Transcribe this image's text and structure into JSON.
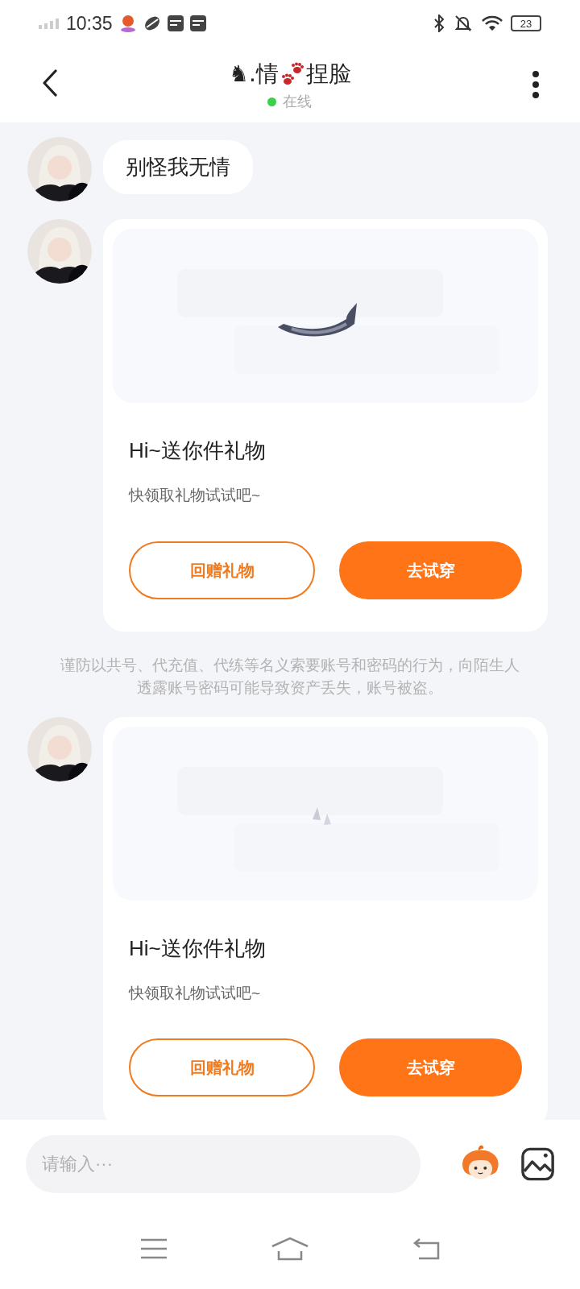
{
  "status_bar": {
    "time": "10:35",
    "battery": "23"
  },
  "header": {
    "title_parts": [
      "♞.情",
      "捏脸"
    ],
    "status": "在线",
    "online": true
  },
  "messages": [
    {
      "kind": "text",
      "text": "别怪我无情"
    },
    {
      "kind": "gift",
      "title": "Hi~送你件礼物",
      "subtitle": "快领取礼物试试吧~",
      "buttons": [
        {
          "label": "回赠礼物",
          "kind": "secondary"
        },
        {
          "label": "去试穿",
          "kind": "primary"
        }
      ]
    },
    {
      "kind": "notice",
      "text": "谨防以共号、代充值、代练等名义索要账号和密码的行为，向陌生人透露账号密码可能导致资产丢失，账号被盗。"
    },
    {
      "kind": "gift",
      "title": "Hi~送你件礼物",
      "subtitle": "快领取礼物试试吧~",
      "buttons": [
        {
          "label": "回赠礼物",
          "kind": "secondary"
        },
        {
          "label": "去试穿",
          "kind": "primary"
        }
      ]
    }
  ],
  "composer": {
    "placeholder": "请输入···"
  }
}
